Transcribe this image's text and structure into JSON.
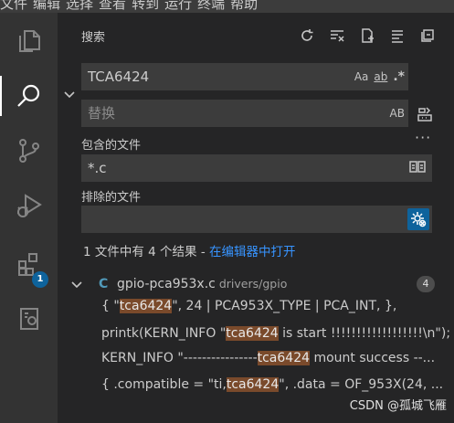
{
  "menubar": {
    "items": [
      "文件",
      "编辑",
      "选择",
      "查看",
      "转到",
      "运行",
      "终端",
      "帮助"
    ]
  },
  "activitybar": {
    "items": [
      {
        "name": "explorer-icon"
      },
      {
        "name": "search-icon"
      },
      {
        "name": "source-control-icon"
      },
      {
        "name": "run-debug-icon"
      },
      {
        "name": "extensions-icon",
        "badge": "1"
      },
      {
        "name": "remote-explorer-icon"
      }
    ],
    "accent": "#0e639c"
  },
  "search": {
    "title": "搜索",
    "query": "TCA6424",
    "case_label": "Aa",
    "word_label": "ab",
    "regex_label": ".*",
    "replace_placeholder": "替换",
    "preserve_case_label": "AB",
    "include_label": "包含的文件",
    "include_value": "*.c",
    "exclude_label": "排除的文件",
    "exclude_value": "",
    "more_label": "···",
    "summary_text": "1 文件中有 4 个结果 - ",
    "summary_link": "在编辑器中打开"
  },
  "result": {
    "lang_label": "C",
    "filename": "gpio-pca953x.c",
    "path": "drivers/gpio",
    "count": "4",
    "matches": [
      {
        "pre": "{ \"",
        "hit": "tca6424",
        "post": "\", 24 | PCA953X_TYPE | PCA_INT, },"
      },
      {
        "pre": "printk(KERN_INFO \"",
        "hit": "tca6424",
        "post": " is start !!!!!!!!!!!!!!!!!!\\n\");"
      },
      {
        "pre": "KERN_INFO \"----------------",
        "hit": "tca6424",
        "post": " mount success --..."
      },
      {
        "pre": "{ .compatible = \"ti,",
        "hit": "tca6424",
        "post": "\", .data = OF_953X(24, ..."
      }
    ],
    "highlight_color": "#7a4a2b"
  },
  "watermark": "CSDN @孤城飞雁"
}
